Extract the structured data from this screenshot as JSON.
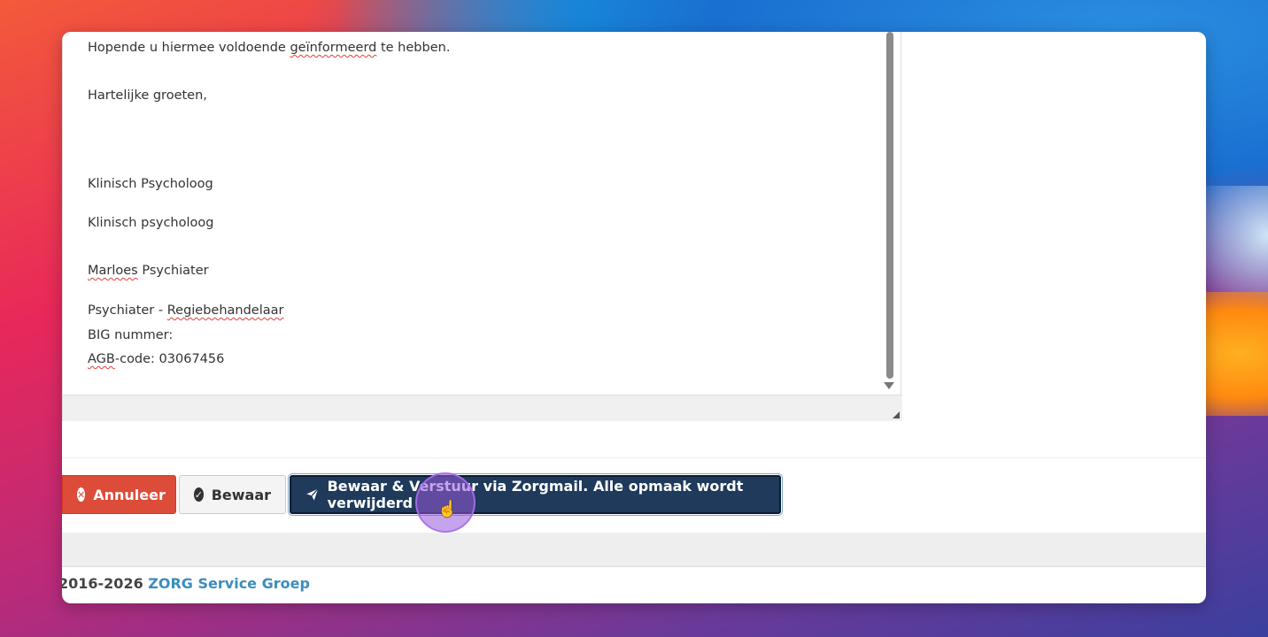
{
  "editor": {
    "lines": [
      {
        "before": "Hopende u hiermee voldoende ",
        "spell": "geïnformeerd",
        "after": " te hebben."
      },
      {
        "text": "Hartelijke groeten,"
      },
      {
        "text": "Klinisch Psycholoog"
      },
      {
        "text": "Klinisch psycholoog"
      },
      {
        "spell": "Marloes",
        "after": " Psychiater"
      },
      {
        "before": "Psychiater - ",
        "spell": "Regiebehandelaar"
      },
      {
        "text": "BIG nummer:"
      },
      {
        "spell": "AGB",
        "after": "-code: 03067456"
      }
    ]
  },
  "buttons": {
    "cancel": {
      "label": "Annuleer",
      "icon": "times-circle-icon",
      "color": "#dd4b39"
    },
    "save": {
      "label": "Bewaar",
      "icon": "check-circle-icon"
    },
    "send": {
      "label": "Bewaar & Verstuur via Zorgmail. Alle opmaak wordt verwijderd",
      "icon": "paper-plane-icon",
      "color": "#1f3a5a"
    }
  },
  "footer": {
    "years": "2016-2026",
    "brand": "ZORG Service Groep",
    "brand_color": "#3c8dbc"
  }
}
